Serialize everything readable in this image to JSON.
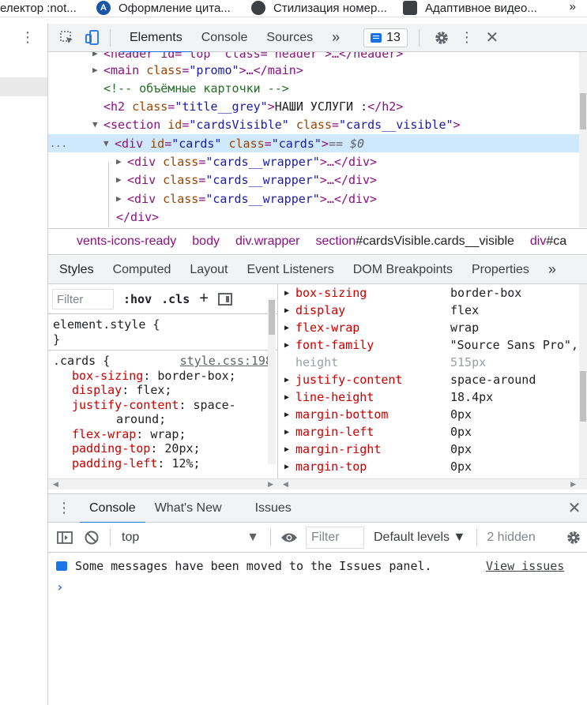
{
  "bookmarks": [
    {
      "label": "електор :not...",
      "icon_color": "#ffffff"
    },
    {
      "label": "Оформление цита...",
      "icon_color": "#1a56a8",
      "icon_letter": "A"
    },
    {
      "label": "Стилизация номер...",
      "icon_color": "#3c4043"
    },
    {
      "label": "Адаптивное видео...",
      "icon_color": "#3c4043"
    }
  ],
  "bookmarks_more": "»",
  "toolbar": {
    "tabs": [
      "Elements",
      "Console",
      "Sources"
    ],
    "active_tab": "Elements",
    "overflow": "»",
    "issues_count": "13"
  },
  "tree": {
    "header_partial": "<header id=\"top\" class=\"header\">…</header>",
    "main": {
      "tag": "main",
      "attr": "class",
      "val": "\"promo\"",
      "rest": "…</main>"
    },
    "comment": "<!-- объёмные карточки -->",
    "h2": {
      "attr": "class",
      "val": "\"title__grey\"",
      "text": "НАШИ УСЛУГИ :"
    },
    "section": {
      "id": "\"cardsVisible\"",
      "class": "\"cards__visible\""
    },
    "selected_div": {
      "id": "\"cards\"",
      "class": "\"cards\"",
      "suffix": " == $0"
    },
    "wrappers": [
      "\"cards__wrapper\"",
      "\"cards__wrapper\"",
      "\"cards__wrapper\""
    ],
    "close_div": "</div>",
    "gutter": "..."
  },
  "breadcrumbs": [
    {
      "text": "vents-icons-ready"
    },
    {
      "text": "body"
    },
    {
      "text": "div.wrapper"
    },
    {
      "tag": "section",
      "rest": "#cardsVisible.cards__visible"
    },
    {
      "tag": "div",
      "rest": "#ca"
    }
  ],
  "styles_tabs": [
    "Styles",
    "Computed",
    "Layout",
    "Event Listeners",
    "DOM Breakpoints",
    "Properties"
  ],
  "styles_tabs_active": "Styles",
  "styles_tabs_overflow": "»",
  "styles": {
    "filter_placeholder": "Filter",
    "hov": ":hov",
    "cls": ".cls",
    "plus": "+",
    "element_style": "element.style {",
    "close_brace": "}",
    "rule_selector": ".cards {",
    "rule_source": "style.css:198",
    "declarations": [
      {
        "prop": "box-sizing",
        "value": "border-box;"
      },
      {
        "prop": "display",
        "value": "flex;"
      },
      {
        "prop": "justify-content",
        "value": "space-"
      },
      {
        "prop": "",
        "value": "around;"
      },
      {
        "prop": "flex-wrap",
        "value": "wrap;"
      },
      {
        "prop": "padding-top",
        "value": "20px;"
      },
      {
        "prop": "padding-left",
        "value": "12%;"
      }
    ]
  },
  "computed": [
    {
      "name": "box-sizing",
      "value": "border-box",
      "inherited": false
    },
    {
      "name": "display",
      "value": "flex",
      "inherited": false
    },
    {
      "name": "flex-wrap",
      "value": "wrap",
      "inherited": false
    },
    {
      "name": "font-family",
      "value": "\"Source Sans Pro\",",
      "inherited": false
    },
    {
      "name": "height",
      "value": "515px",
      "inherited": true
    },
    {
      "name": "justify-content",
      "value": "space-around",
      "inherited": false
    },
    {
      "name": "line-height",
      "value": "18.4px",
      "inherited": false
    },
    {
      "name": "margin-bottom",
      "value": "0px",
      "inherited": false
    },
    {
      "name": "margin-left",
      "value": "0px",
      "inherited": false
    },
    {
      "name": "margin-right",
      "value": "0px",
      "inherited": false
    },
    {
      "name": "margin-top",
      "value": "0px",
      "inherited": false
    }
  ],
  "drawer": {
    "tabs": [
      "Console",
      "What's New",
      "Issues"
    ],
    "active_tab": "Console"
  },
  "console": {
    "context": "top",
    "filter_placeholder": "Filter",
    "levels": "Default levels ▼",
    "hidden": "2 hidden",
    "message": "Some messages have been moved to the Issues panel.",
    "view_issues": "View issues",
    "prompt": "›"
  },
  "colors": {
    "accent": "#1a73e8",
    "tag": "#881280",
    "attr_name": "#994500",
    "attr_value": "#1a1aa6",
    "property": "#c80000",
    "comment": "#236e25",
    "selected_row": "#cfe8fc"
  }
}
